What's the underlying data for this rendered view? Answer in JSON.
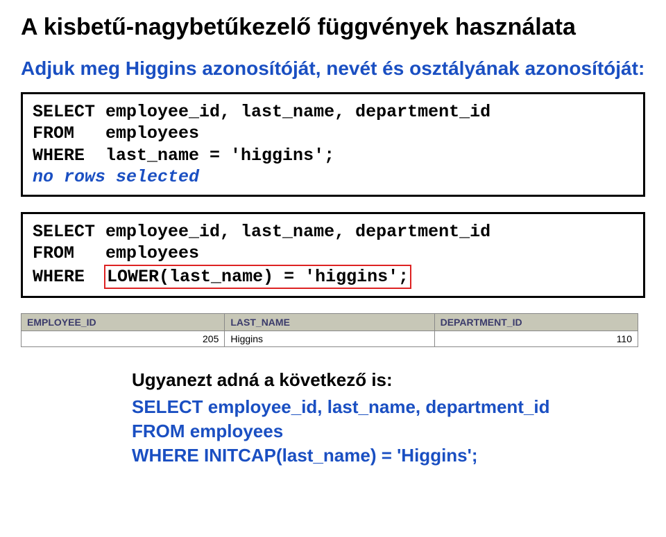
{
  "title": "A kisbetű-nagybetűkezelő függvények használata",
  "subtitle": "Adjuk meg Higgins azonosítóját, nevét és osztályának azonosítóját:",
  "code1": {
    "l1": "SELECT employee_id, last_name, department_id",
    "l2": "FROM   employees",
    "l3": "WHERE  last_name = 'higgins';",
    "result": "no rows selected"
  },
  "code2": {
    "l1": "SELECT employee_id, last_name, department_id",
    "l2": "FROM   employees",
    "l3pre": "WHERE  ",
    "l3box": "LOWER(last_name) = 'higgins';"
  },
  "table": {
    "h1": "EMPLOYEE_ID",
    "h2": "LAST_NAME",
    "h3": "DEPARTMENT_ID",
    "r1c1": "205",
    "r1c2": "Higgins",
    "r1c3": "110"
  },
  "footnote": {
    "intro": "Ugyanezt adná a következő is:",
    "l1": "SELECT employee_id, last_name, department_id",
    "l2": "FROM   employees",
    "l3": "WHERE  INITCAP(last_name) = 'Higgins';"
  }
}
